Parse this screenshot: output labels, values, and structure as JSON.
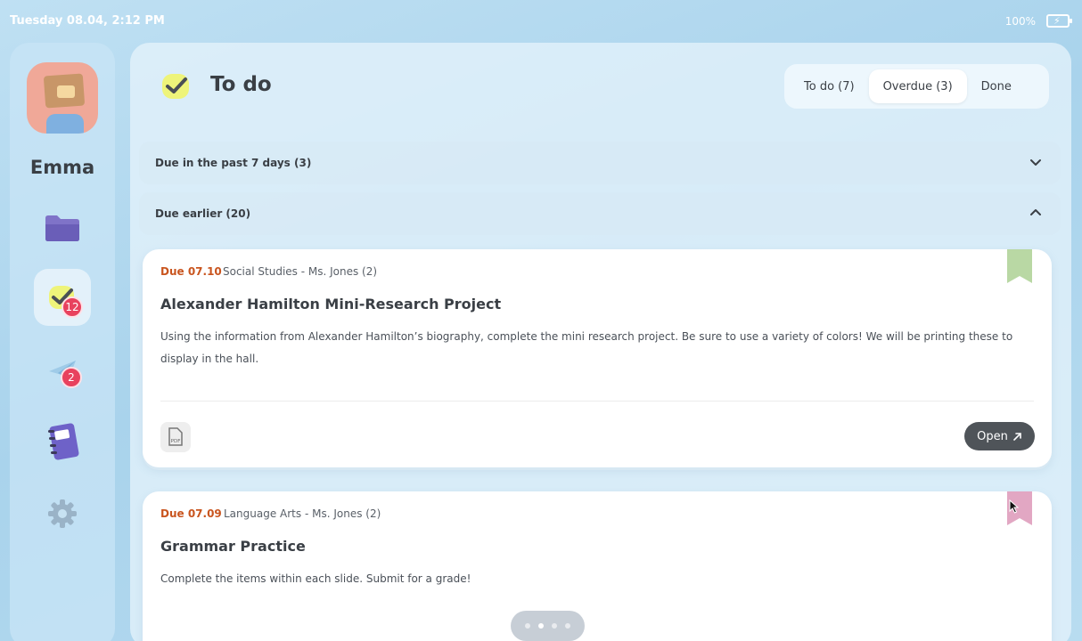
{
  "status_bar": {
    "datetime": "Tuesday 08.04, 2:12 PM",
    "battery": "100%"
  },
  "sidebar": {
    "user_name": "Emma",
    "items": [
      {
        "name": "folder",
        "icon": "folder-icon",
        "badge": ""
      },
      {
        "name": "todo",
        "icon": "checkmark-icon",
        "badge": "12",
        "active": true
      },
      {
        "name": "messages",
        "icon": "paper-plane-icon",
        "badge": "2"
      },
      {
        "name": "notebook",
        "icon": "notebook-icon",
        "badge": ""
      },
      {
        "name": "settings",
        "icon": "gear-icon",
        "badge": ""
      }
    ]
  },
  "header": {
    "title": "To do",
    "tabs": [
      {
        "label": "To do (7)",
        "selected": false
      },
      {
        "label": "Overdue (3)",
        "selected": true
      },
      {
        "label": "Done",
        "selected": false
      }
    ]
  },
  "sections": [
    {
      "label": "Due in the past 7 days (3)",
      "expanded": false
    },
    {
      "label": "Due earlier (20)",
      "expanded": true
    }
  ],
  "assignments": [
    {
      "due": "Due 07.10",
      "course": "Social Studies - Ms. Jones (2)",
      "title": "Alexander Hamilton Mini-Research Project",
      "description": "Using the information from Alexander Hamilton’s biography, complete the mini research project. Be sure to use a variety of colors! We will be printing these to display in the hall.",
      "attachment": "PDF",
      "action": "Open",
      "bookmark_color": "#b9d8a4"
    },
    {
      "due": "Due 07.09",
      "course": "Language Arts - Ms. Jones (2)",
      "title": "Grammar Practice",
      "description": "Complete the items within each slide. Submit for a grade!",
      "bookmark_color": "#e2a7c3"
    }
  ],
  "pager": {
    "pages": 4,
    "current": 2
  },
  "colors": {
    "due_text": "#c9551f",
    "badge": "#e8425e",
    "open_button": "#4f5459"
  }
}
